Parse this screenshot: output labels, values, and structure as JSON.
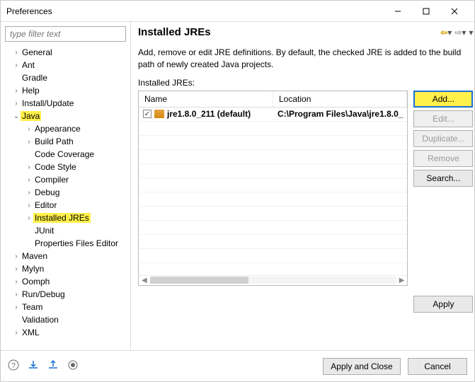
{
  "window": {
    "title": "Preferences"
  },
  "filter_placeholder": "type filter text",
  "tree": [
    {
      "label": "General",
      "depth": 1,
      "exp": ">"
    },
    {
      "label": "Ant",
      "depth": 1,
      "exp": ">"
    },
    {
      "label": "Gradle",
      "depth": 1,
      "exp": ""
    },
    {
      "label": "Help",
      "depth": 1,
      "exp": ">"
    },
    {
      "label": "Install/Update",
      "depth": 1,
      "exp": ">"
    },
    {
      "label": "Java",
      "depth": 1,
      "exp": "v",
      "hl": true
    },
    {
      "label": "Appearance",
      "depth": 2,
      "exp": ">"
    },
    {
      "label": "Build Path",
      "depth": 2,
      "exp": ">"
    },
    {
      "label": "Code Coverage",
      "depth": 2,
      "exp": ""
    },
    {
      "label": "Code Style",
      "depth": 2,
      "exp": ">"
    },
    {
      "label": "Compiler",
      "depth": 2,
      "exp": ">"
    },
    {
      "label": "Debug",
      "depth": 2,
      "exp": ">"
    },
    {
      "label": "Editor",
      "depth": 2,
      "exp": ">"
    },
    {
      "label": "Installed JREs",
      "depth": 2,
      "exp": ">",
      "hl": true
    },
    {
      "label": "JUnit",
      "depth": 2,
      "exp": ""
    },
    {
      "label": "Properties Files Editor",
      "depth": 2,
      "exp": ""
    },
    {
      "label": "Maven",
      "depth": 1,
      "exp": ">"
    },
    {
      "label": "Mylyn",
      "depth": 1,
      "exp": ">"
    },
    {
      "label": "Oomph",
      "depth": 1,
      "exp": ">"
    },
    {
      "label": "Run/Debug",
      "depth": 1,
      "exp": ">"
    },
    {
      "label": "Team",
      "depth": 1,
      "exp": ">"
    },
    {
      "label": "Validation",
      "depth": 1,
      "exp": ""
    },
    {
      "label": "XML",
      "depth": 1,
      "exp": ">"
    }
  ],
  "page": {
    "title": "Installed JREs",
    "description": "Add, remove or edit JRE definitions. By default, the checked JRE is added to the build path of newly created Java projects.",
    "section_label": "Installed JREs:",
    "columns": {
      "name": "Name",
      "location": "Location"
    },
    "rows": [
      {
        "checked": true,
        "name": "jre1.8.0_211 (default)",
        "location": "C:\\Program Files\\Java\\jre1.8.0_"
      }
    ],
    "buttons": {
      "add": "Add...",
      "edit": "Edit...",
      "duplicate": "Duplicate...",
      "remove": "Remove",
      "search": "Search..."
    },
    "apply": "Apply"
  },
  "footer": {
    "apply_close": "Apply and Close",
    "cancel": "Cancel"
  }
}
